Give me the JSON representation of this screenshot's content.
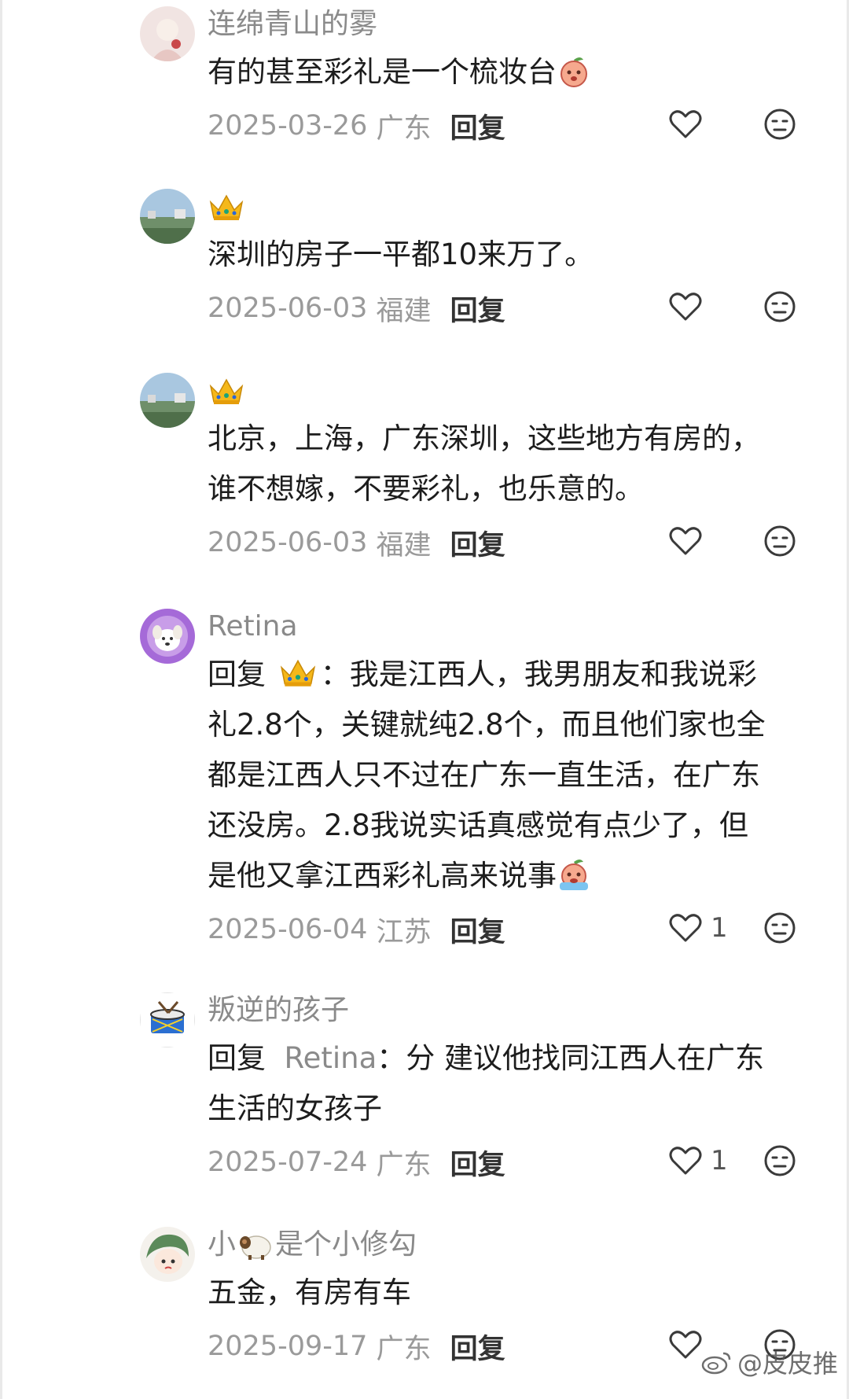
{
  "comments": [
    {
      "username": "连绵青山的雾",
      "text": "有的甚至彩礼是一个梳妆台",
      "date": "2025-03-26",
      "location": "广东",
      "reply_label": "回复",
      "likes": ""
    },
    {
      "username": "",
      "text": "深圳的房子一平都10来万了。",
      "date": "2025-06-03",
      "location": "福建",
      "reply_label": "回复",
      "likes": ""
    },
    {
      "username": "",
      "text_line1": "北京，上海，广东深圳，这些地方有房的，",
      "text_line2": "谁不想嫁，不要彩礼，也乐意的。",
      "date": "2025-06-03",
      "location": "福建",
      "reply_label": "回复",
      "likes": ""
    },
    {
      "username": "Retina",
      "reply_prefix": "回复",
      "reply_colon": "：",
      "text_line1": "我是江西人，我男朋友和我说彩",
      "text_line2": "礼2.8个，关键就纯2.8个，而且他们家也全",
      "text_line3": "都是江西人只不过在广东一直生活，在广东",
      "text_line4": "还没房。2.8我说实话真感觉有点少了，但",
      "text_line5": "是他又拿江西彩礼高来说事",
      "date": "2025-06-04",
      "location": "江苏",
      "reply_label": "回复",
      "likes": "1"
    },
    {
      "username": "叛逆的孩子",
      "reply_prefix": "回复",
      "reply_target": "Retina",
      "reply_colon": "：",
      "text_line1": "分 建议他找同江西人在广东",
      "text_line2": "生活的女孩子",
      "date": "2025-07-24",
      "location": "广东",
      "reply_label": "回复",
      "likes": "1"
    },
    {
      "username_part1": "小",
      "username_part2": "是个小修勾",
      "text": "五金，有房有车",
      "date": "2025-09-17",
      "location": "广东",
      "reply_label": "回复",
      "likes": ""
    }
  ],
  "watermark": "@皮皮推",
  "icons": [
    "heart-outline-icon",
    "dislike-face-icon",
    "crown-icon",
    "peach-emoji-icon",
    "weibo-logo-icon"
  ]
}
